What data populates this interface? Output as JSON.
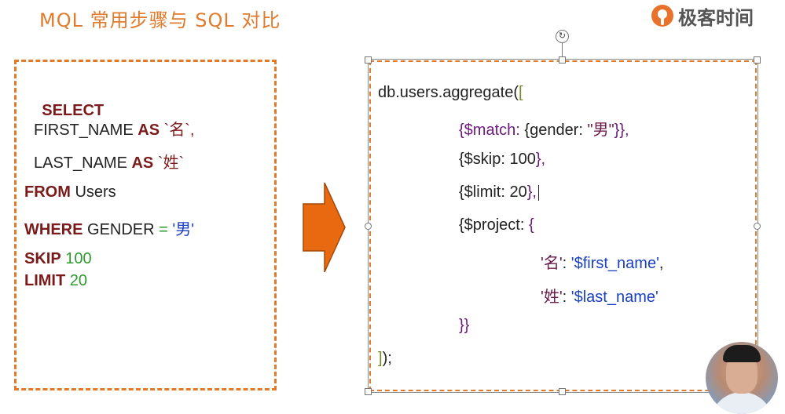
{
  "header": {
    "title": "MQL 常用步骤与 SQL 对比",
    "brand": "极客时间",
    "brand_color": "#e8722b"
  },
  "sql": {
    "line1": {
      "kw": "SELECT"
    },
    "line2": {
      "col": "FIRST_NAME ",
      "kw": "AS",
      "alias": " `名`,"
    },
    "line3": {
      "col": "LAST_NAME ",
      "kw": "AS",
      "alias": " `姓`"
    },
    "line4": {
      "kw": "FROM",
      "rest": " Users"
    },
    "line5": {
      "kw": "WHERE",
      "rest": " GENDER ",
      "op": "=",
      "val": " '男'"
    },
    "line6": {
      "kw": "SKIP",
      "num": " 100"
    },
    "line7": {
      "kw": "LIMIT",
      "num": " 20"
    }
  },
  "mql": {
    "l1_a": "db.users.aggregate(",
    "l1_b": "[",
    "l2_a": "{$match: ",
    "l2_b": "{gender: ",
    "l2_c": "\"男\"",
    "l2_d": "}},",
    "l3_a": "{$skip: 100",
    "l3_b": "},",
    "l4_a": "{$limit: 20",
    "l4_b": "},",
    "l5_a": "{$project: ",
    "l5_b": "{",
    "l6_a": "'名'",
    "l6_b": ": ",
    "l6_c": "'$first_name'",
    "l6_d": ",",
    "l7_a": "'姓'",
    "l7_b": ": ",
    "l7_c": "'$last_name'",
    "l8": "}}",
    "l9_a": "]",
    "l9_b": ");"
  },
  "icons": {
    "rotate": "↻"
  },
  "colors": {
    "accent": "#e07a2c",
    "keyword": "#7a1a1a",
    "number": "#2e9b2e",
    "string": "#1a3fbf"
  }
}
